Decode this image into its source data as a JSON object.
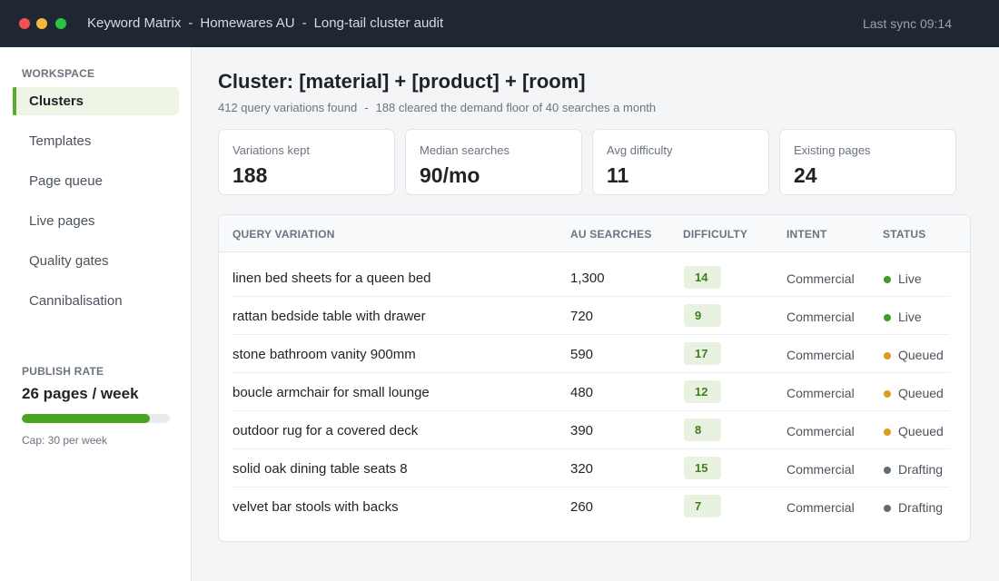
{
  "window": {
    "app": "Keyword Matrix",
    "project": "Homewares AU",
    "view": "Long-tail cluster audit",
    "separator": "-",
    "sync": "Last sync 09:14"
  },
  "sidebar": {
    "section": "WORKSPACE",
    "items": [
      {
        "label": "Clusters",
        "active": true
      },
      {
        "label": "Templates"
      },
      {
        "label": "Page queue"
      },
      {
        "label": "Live pages"
      },
      {
        "label": "Quality gates"
      },
      {
        "label": "Cannibalisation"
      }
    ],
    "publish": {
      "section": "PUBLISH RATE",
      "value": "26 pages / week",
      "progress_fraction": 0.867,
      "cap": "Cap: 30 per week",
      "color": "#4aa321"
    }
  },
  "main": {
    "title": "Cluster: [material] + [product] + [room]",
    "subtitle_found": "412 query variations found",
    "subtitle_sep": "-",
    "subtitle_cleared": "188 cleared the demand floor of 40 searches a month",
    "cards": [
      {
        "label": "Variations kept",
        "value": "188"
      },
      {
        "label": "Median searches",
        "value": "90/mo"
      },
      {
        "label": "Avg difficulty",
        "value": "11"
      },
      {
        "label": "Existing pages",
        "value": "24"
      }
    ]
  },
  "table": {
    "headers": {
      "query": "QUERY VARIATION",
      "searches": "AU SEARCHES",
      "difficulty": "DIFFICULTY",
      "intent": "INTENT",
      "status": "STATUS"
    },
    "rows": [
      {
        "query": "linen bed sheets for a queen bed",
        "searches": "1,300",
        "difficulty": "14",
        "intent": "Commercial",
        "status": "Live"
      },
      {
        "query": "rattan bedside table with drawer",
        "searches": "720",
        "difficulty": "9",
        "intent": "Commercial",
        "status": "Live"
      },
      {
        "query": "stone bathroom vanity 900mm",
        "searches": "590",
        "difficulty": "17",
        "intent": "Commercial",
        "status": "Queued"
      },
      {
        "query": "boucle armchair for small lounge",
        "searches": "480",
        "difficulty": "12",
        "intent": "Commercial",
        "status": "Queued"
      },
      {
        "query": "outdoor rug for a covered deck",
        "searches": "390",
        "difficulty": "8",
        "intent": "Commercial",
        "status": "Queued"
      },
      {
        "query": "solid oak dining table seats 8",
        "searches": "320",
        "difficulty": "15",
        "intent": "Commercial",
        "status": "Drafting"
      },
      {
        "query": "velvet bar stools with backs",
        "searches": "260",
        "difficulty": "7",
        "intent": "Commercial",
        "status": "Drafting"
      }
    ],
    "status_colors": {
      "Live": "#3e9d22",
      "Queued": "#e09a18",
      "Drafting": "#5f6b78"
    }
  }
}
